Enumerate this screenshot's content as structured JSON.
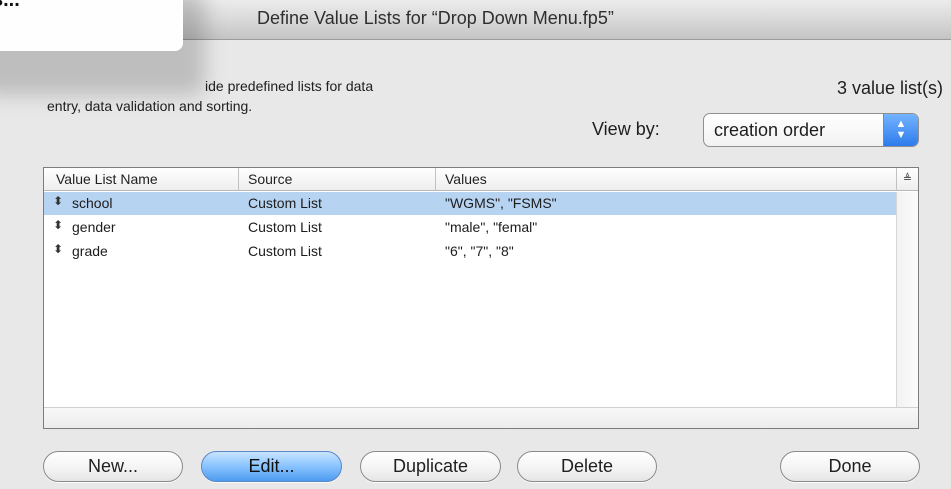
{
  "popup": {
    "text": "s..."
  },
  "window": {
    "title": "Define Value Lists for “Drop Down Menu.fp5”"
  },
  "header": {
    "description_line1": "ide predefined lists for data",
    "description_line2": "entry, data validation and sorting.",
    "count_label": "3 value list(s)",
    "view_by_label": "View by:",
    "view_by_value": "creation order"
  },
  "table": {
    "columns": [
      "Value List Name",
      "Source",
      "Values"
    ],
    "sort_icon": "sort-icon",
    "rows": [
      {
        "name": "school",
        "source": "Custom List",
        "values": "\"WGMS\", \"FSMS\"",
        "selected": true
      },
      {
        "name": "gender",
        "source": "Custom List",
        "values": "\"male\", \"femal\"",
        "selected": false
      },
      {
        "name": "grade",
        "source": "Custom List",
        "values": "\"6\", \"7\", \"8\"",
        "selected": false
      }
    ]
  },
  "buttons": {
    "new": "New...",
    "edit": "Edit...",
    "duplicate": "Duplicate",
    "delete": "Delete",
    "done": "Done"
  },
  "colors": {
    "selection": "#b7d3f2",
    "accent": "#4d9bf0"
  }
}
